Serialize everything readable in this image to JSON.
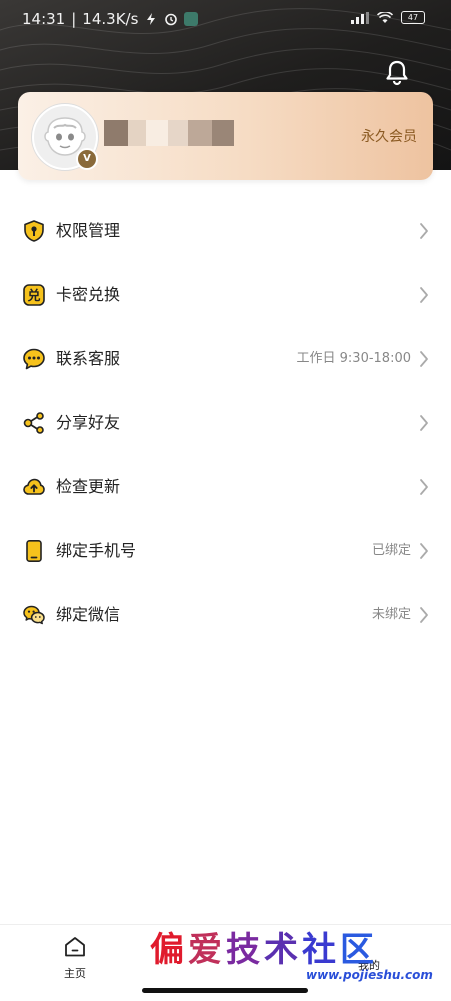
{
  "status_bar": {
    "time": "14:31",
    "speed": "14.3K/s",
    "battery": "47"
  },
  "card": {
    "member_label": "永久会员",
    "badge": "V"
  },
  "menu": [
    {
      "icon": "shield-key-icon",
      "label": "权限管理",
      "value": ""
    },
    {
      "icon": "redeem-icon",
      "label": "卡密兑换",
      "value": ""
    },
    {
      "icon": "chat-bubble-icon",
      "label": "联系客服",
      "value": "工作日 9:30-18:00"
    },
    {
      "icon": "share-icon",
      "label": "分享好友",
      "value": ""
    },
    {
      "icon": "cloud-upload-icon",
      "label": "检查更新",
      "value": ""
    },
    {
      "icon": "phone-icon",
      "label": "绑定手机号",
      "value": "已绑定"
    },
    {
      "icon": "wechat-icon",
      "label": "绑定微信",
      "value": "未绑定"
    }
  ],
  "redeem_glyph": "兑",
  "bottom_nav": {
    "home_label": "主页",
    "mine_label": "我的"
  },
  "watermark": {
    "c1": "偏",
    "c2": "爱",
    "c3": "技",
    "c4": "术",
    "c5": "社",
    "c6": "区",
    "url": "www.pojieshu.com"
  },
  "colors": {
    "accent_yellow": "#f6c21c",
    "member_brown": "#8b5a22"
  }
}
